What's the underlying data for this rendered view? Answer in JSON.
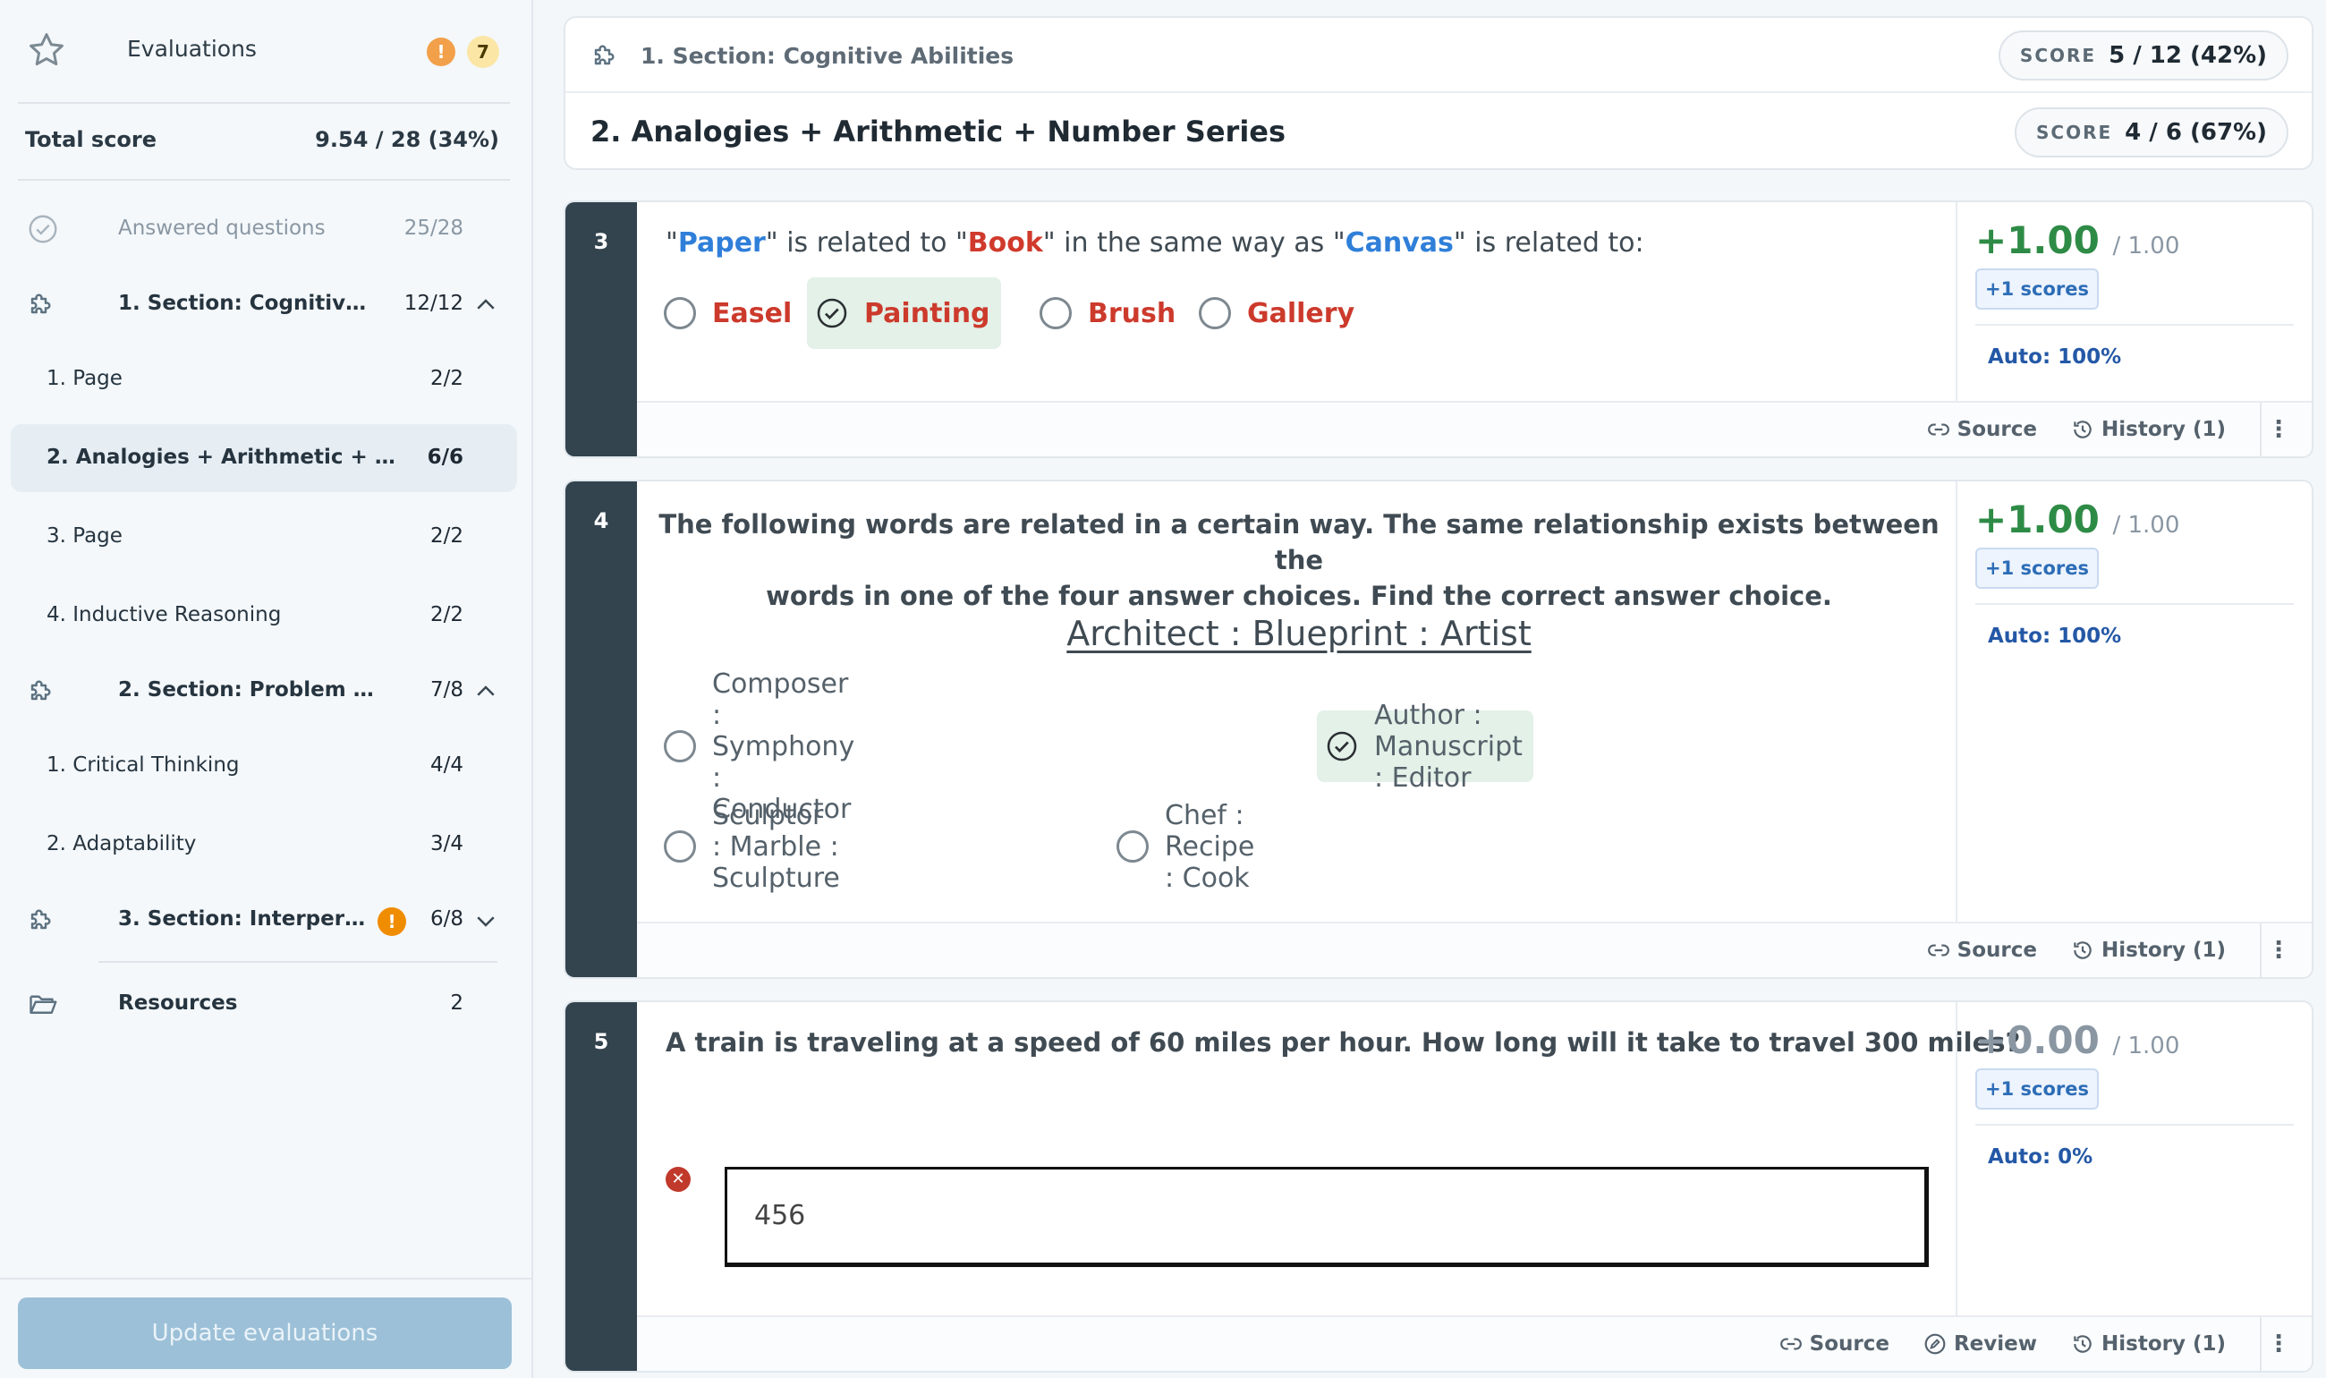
{
  "sidebar": {
    "title": "Evaluations",
    "warning_badge": "!",
    "badge_count": "7",
    "total_label": "Total score",
    "total_value": "9.54 / 28 (34%)",
    "answered": {
      "label": "Answered questions",
      "count": "25/28"
    },
    "sections": [
      {
        "label": "1. Section: Cognitive A...",
        "count": "12/12",
        "expanded": true,
        "pages": [
          {
            "label": "1. Page",
            "count": "2/2"
          },
          {
            "label": "2. Analogies + Arithmetic + N...",
            "count": "6/6",
            "active": true
          },
          {
            "label": "3. Page",
            "count": "2/2"
          },
          {
            "label": "4. Inductive Reasoning",
            "count": "2/2"
          }
        ]
      },
      {
        "label": "2. Section: Problem Sol...",
        "count": "7/8",
        "expanded": true,
        "pages": [
          {
            "label": "1. Critical Thinking",
            "count": "4/4"
          },
          {
            "label": "2. Adaptability",
            "count": "3/4"
          }
        ]
      },
      {
        "label": "3. Section: Interperson...",
        "count": "6/8",
        "expanded": false,
        "warning": "!"
      }
    ],
    "resources": {
      "label": "Resources",
      "count": "2"
    },
    "update_button": "Update evaluations"
  },
  "header": {
    "section_title": "1. Section: Cognitive Abilities",
    "section_score_key": "SCORE",
    "section_score": "5 / 12 (42%)",
    "page_title": "2. Analogies + Arithmetic + Number Series",
    "page_score_key": "SCORE",
    "page_score": "4 / 6 (67%)"
  },
  "questions": [
    {
      "number": "3",
      "text_parts": [
        "\"",
        "Paper",
        "\" is related to \"",
        "Book",
        "\" in the same way as \"",
        "Canvas",
        "\" is related to:"
      ],
      "options": [
        {
          "label": "Easel",
          "selected": false
        },
        {
          "label": "Painting",
          "selected": true
        },
        {
          "label": "Brush",
          "selected": false
        },
        {
          "label": "Gallery",
          "selected": false
        }
      ],
      "score": "+1.00",
      "max": "/ 1.00",
      "plus_scores": "+1 scores",
      "auto": "Auto: 100%",
      "actions": [
        "Source",
        "History (1)"
      ]
    },
    {
      "number": "4",
      "instruction_line1": "The following words are related in a certain way. The same relationship exists between the",
      "instruction_line2": "words in one of the four answer choices. Find the correct answer choice.",
      "analogy": "Architect : Blueprint : Artist",
      "options": [
        {
          "label": "Composer : Symphony : Conductor",
          "selected": false
        },
        {
          "label": "Author : Manuscript : Editor",
          "selected": true
        },
        {
          "label": "Sculptor : Marble : Sculpture",
          "selected": false
        },
        {
          "label": "Chef : Recipe : Cook",
          "selected": false
        }
      ],
      "score": "+1.00",
      "max": "/ 1.00",
      "plus_scores": "+1 scores",
      "auto": "Auto: 100%",
      "actions": [
        "Source",
        "History (1)"
      ]
    },
    {
      "number": "5",
      "text": "A train is traveling at a speed of 60 miles per hour. How long will it take to travel 300 miles?",
      "answer": "456",
      "answer_status": "incorrect",
      "score": "+0.00",
      "max": "/ 1.00",
      "plus_scores": "+1 scores",
      "auto": "Auto: 0%",
      "actions": [
        "Source",
        "Review",
        "History (1)"
      ]
    }
  ],
  "colors": {
    "correct_score": "#2e8b46",
    "zero_score": "#8a97a3",
    "accent_blue": "#2f7fd9",
    "accent_red": "#cc3a2c",
    "sidebar_bar": "#33444f"
  }
}
